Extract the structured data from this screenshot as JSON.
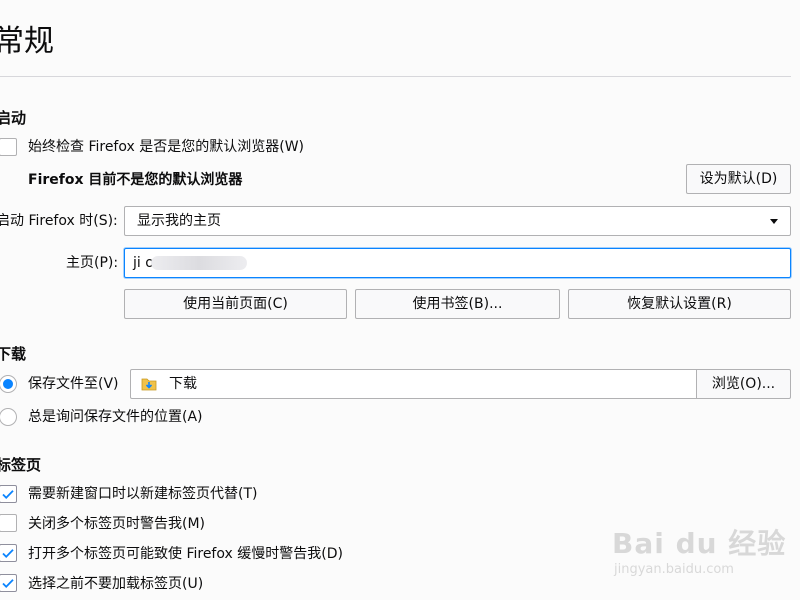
{
  "page": {
    "title": "常规"
  },
  "startup": {
    "heading": "启动",
    "always_check_default_label": "始终检查 Firefox 是否是您的默认浏览器(W)",
    "not_default_message": "Firefox 目前不是您的默认浏览器",
    "set_default_button": "设为默认(D)",
    "when_starts_label": "启动 Firefox 时(S):",
    "when_starts_value": "显示我的主页",
    "homepage_label": "主页(P):",
    "homepage_value": "ji                         om",
    "use_current_pages_button": "使用当前页面(C)",
    "use_bookmark_button": "使用书签(B)...",
    "restore_default_button": "恢复默认设置(R)"
  },
  "downloads": {
    "heading": "下载",
    "save_files_to_label": "保存文件至(V)",
    "save_path_value": "下载",
    "browse_button": "浏览(O)...",
    "always_ask_label": "总是询问保存文件的位置(A)"
  },
  "tabs": {
    "heading": "标签页",
    "items": [
      {
        "label": "需要新建窗口时以新建标签页代替(T)",
        "checked": true
      },
      {
        "label": "关闭多个标签页时警告我(M)",
        "checked": false
      },
      {
        "label": "打开多个标签页可能致使 Firefox 缓慢时警告我(D)",
        "checked": true
      },
      {
        "label": "选择之前不要加载标签页(U)",
        "checked": true
      }
    ]
  },
  "watermark": {
    "brand": "Bai du 经验",
    "url": "jingyan.baidu.com"
  },
  "colors": {
    "accent": "#0a84ff",
    "border": "#b1b1b3",
    "text": "#0c0c0d",
    "background": "#fbfbfb"
  },
  "icons": {
    "check": "checkmark-icon",
    "folder": "download-folder-icon",
    "dropdown": "chevron-down-icon"
  }
}
